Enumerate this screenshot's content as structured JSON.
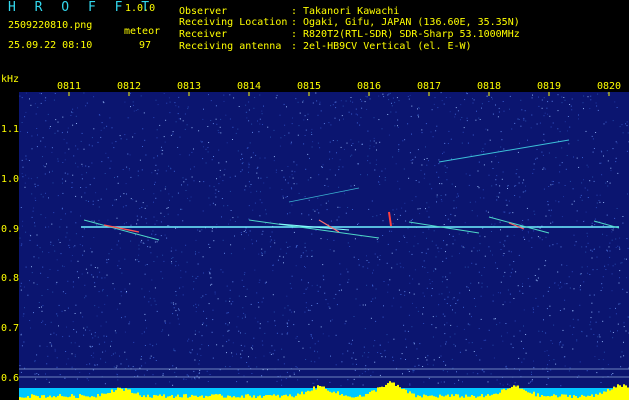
{
  "app": {
    "title": "H R O F F T",
    "version": "1.0.0"
  },
  "file": {
    "name": "2509220810.png",
    "datetime": "25.09.22 08:10"
  },
  "meteor": {
    "label": "meteor",
    "count": "97"
  },
  "info": [
    {
      "label": "Observer",
      "value": "Takanori Kawachi"
    },
    {
      "label": "Receiving Location",
      "value": "Ogaki, Gifu, JAPAN (136.60E, 35.35N)"
    },
    {
      "label": "Receiver",
      "value": "R820T2(RTL-SDR) SDR-Sharp 53.1000MHz"
    },
    {
      "label": "Receiving antenna",
      "value": "2el-HB9CV Vertical (el. E-W)"
    }
  ],
  "axis": {
    "y_unit": "kHz",
    "y_labels": [
      "1.1",
      "1.0",
      "0.9",
      "0.8",
      "0.7",
      "0.6"
    ],
    "x_labels": [
      "0811",
      "0812",
      "0813",
      "0814",
      "0815",
      "0816",
      "0817",
      "0818",
      "0819",
      "0820"
    ]
  },
  "colors": {
    "label": "#ffff00",
    "title": "#33d8ee",
    "background": "#0b1570",
    "signal": "#6ff0ff",
    "level": "#ffff00"
  }
}
